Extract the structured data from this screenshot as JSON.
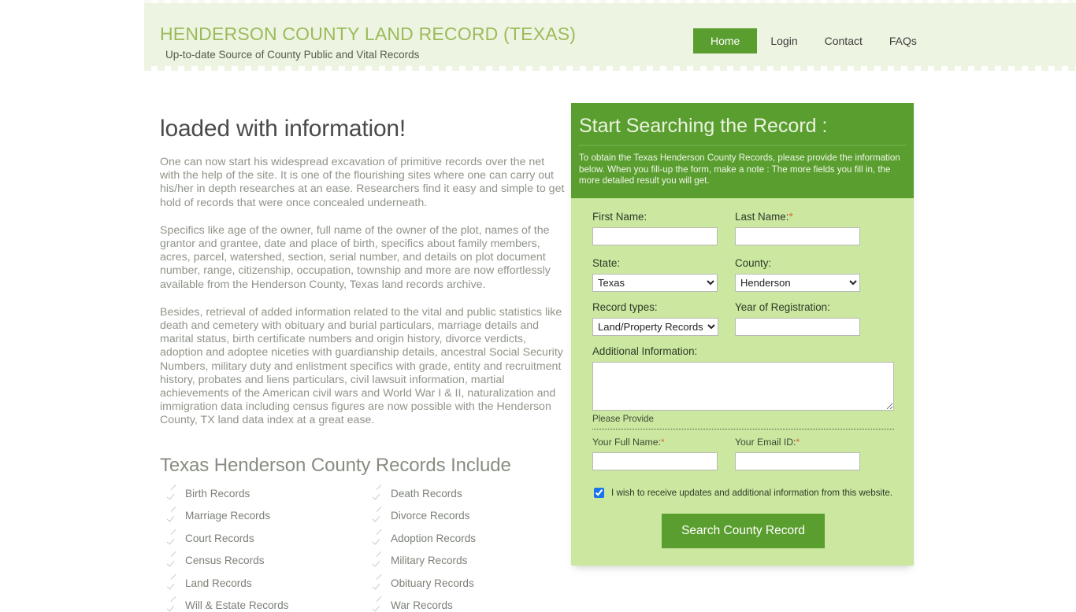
{
  "header": {
    "title": "HENDERSON COUNTY LAND RECORD (TEXAS)",
    "tagline": "Up-to-date Source of  County Public and Vital Records",
    "nav": [
      {
        "label": "Home",
        "active": true
      },
      {
        "label": "Login",
        "active": false
      },
      {
        "label": "Contact",
        "active": false
      },
      {
        "label": "FAQs",
        "active": false
      }
    ]
  },
  "main": {
    "lead_heading": "loaded with information!",
    "paragraphs": [
      "One can now start his widespread excavation of primitive records over the net with the help of the site. It is one of the flourishing sites where one can carry out his/her in depth researches at an ease. Researchers find it easy and simple to get hold of records that were once concealed underneath.",
      "Specifics like age of the owner, full name of the owner of the plot, names of the grantor and grantee, date and place of birth, specifics about family members, acres, parcel, watershed, section, serial number, and details on plot document number, range, citizenship, occupation, township and more are now effortlessly available from the Henderson County, Texas land records archive.",
      "Besides, retrieval of added information related to the vital and public statistics like death and cemetery with obituary and burial particulars, marriage details and marital status, birth certificate numbers and origin history, divorce verdicts, adoption and adoptee niceties with guardianship details, ancestral Social Security Numbers, military duty and enlistment specifics with grade, entity and recruitment history, probates and liens particulars, civil lawsuit information, martial achievements of the American civil wars and World War I & II, naturalization and immigration data including census figures are now possible with the Henderson County, TX land data index at a great ease."
    ],
    "records_heading": "Texas Henderson County Records Include",
    "records": [
      "Birth Records",
      "Death Records",
      "Marriage Records",
      "Divorce Records",
      "Court Records",
      "Adoption Records",
      "Census Records",
      "Military Records",
      "Land Records",
      "Obituary Records",
      "Will & Estate Records",
      "War Records"
    ]
  },
  "form": {
    "title": "Start Searching the Record :",
    "description": "To obtain the Texas Henderson County Records, please provide the information below. When you fill-up the form, make a note : The more fields you fill in, the more detailed result you will get.",
    "first_name_label": "First Name:",
    "first_name_value": "",
    "last_name_label": "Last Name:",
    "last_name_required": "*",
    "last_name_value": "",
    "state_label": "State:",
    "state_value": "Texas",
    "state_options": [
      "Texas"
    ],
    "county_label": "County:",
    "county_value": "Henderson",
    "county_options": [
      "Henderson"
    ],
    "record_types_label": "Record types:",
    "record_types_value": "Land/Property Records",
    "record_types_options": [
      "Land/Property Records"
    ],
    "year_label": "Year of Registration:",
    "year_value": "",
    "additional_label": "Additional Information:",
    "additional_value": "",
    "please_provide": "Please Provide",
    "full_name_label": "Your Full Name:",
    "full_name_required": "*",
    "full_name_value": "",
    "email_label": "Your Email ID:",
    "email_required": "*",
    "email_value": "",
    "optin_label": "I wish to receive updates and additional information from this website.",
    "optin_checked": true,
    "submit_label": "Search County Record"
  },
  "colors": {
    "header_band": "#eef4e2",
    "brand_green": "#5a9e2f",
    "panel_body": "#cbe7a0",
    "title_green": "#9bbb59",
    "required_orange": "#e2653c",
    "checkbox_blue": "#1a73e8"
  }
}
